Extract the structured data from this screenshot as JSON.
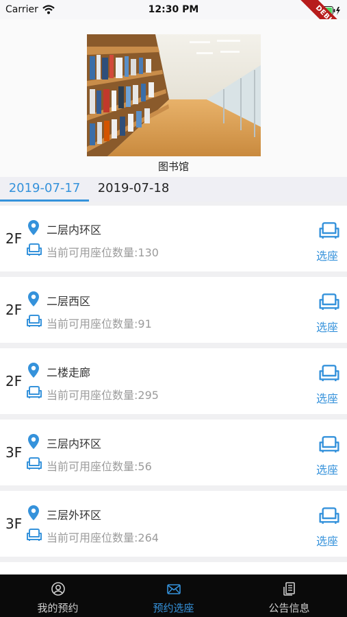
{
  "status_bar": {
    "carrier": "Carrier",
    "time": "12:30 PM",
    "debug_label": "DEBUG"
  },
  "header": {
    "library_name": "图书馆"
  },
  "date_tabs": [
    {
      "label": "2019-07-17",
      "selected": true
    },
    {
      "label": "2019-07-18",
      "selected": false
    }
  ],
  "areas": [
    {
      "floor": "2F",
      "zone": "二层内环区",
      "available_text": "当前可用座位数量:130",
      "action": "选座"
    },
    {
      "floor": "2F",
      "zone": "二层西区",
      "available_text": "当前可用座位数量:91",
      "action": "选座"
    },
    {
      "floor": "2F",
      "zone": "二楼走廊",
      "available_text": "当前可用座位数量:295",
      "action": "选座"
    },
    {
      "floor": "3F",
      "zone": "三层内环区",
      "available_text": "当前可用座位数量:56",
      "action": "选座"
    },
    {
      "floor": "3F",
      "zone": "三层外环区",
      "available_text": "当前可用座位数量:264",
      "action": "选座"
    }
  ],
  "bottom_nav": [
    {
      "label": "我的预约",
      "icon": "user-circle-icon",
      "active": false
    },
    {
      "label": "预约选座",
      "icon": "envelope-icon",
      "active": true
    },
    {
      "label": "公告信息",
      "icon": "document-icon",
      "active": false
    }
  ],
  "colors": {
    "accent": "#3592db",
    "muted_text": "#9b9b9b",
    "nav_bg": "#0a0a0a",
    "nav_inactive": "#cfcfcf"
  }
}
